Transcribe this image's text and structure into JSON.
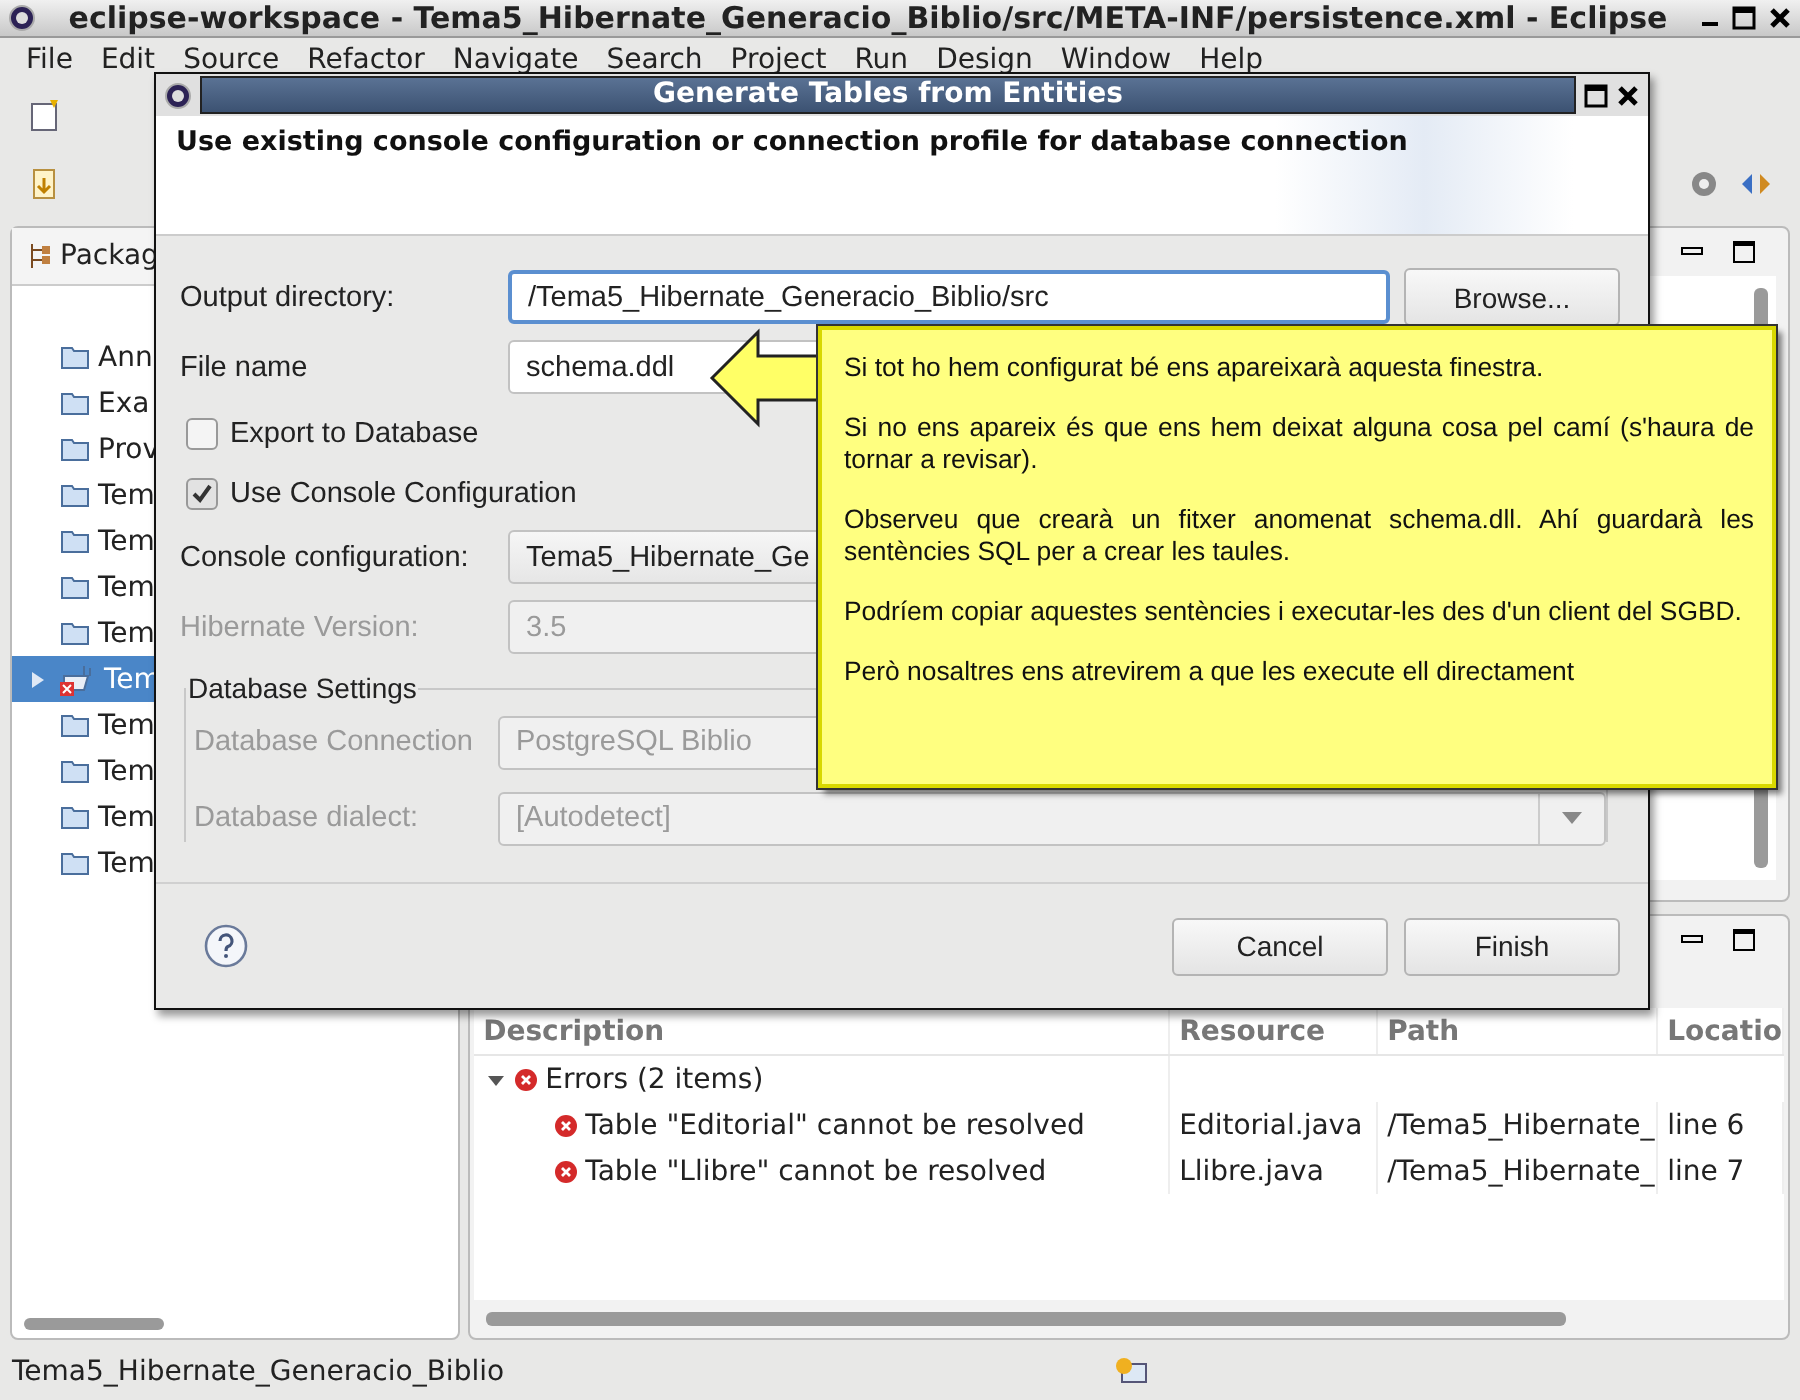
{
  "window": {
    "title": "eclipse-workspace - Tema5_Hibernate_Generacio_Biblio/src/META-INF/persistence.xml - Eclipse"
  },
  "menu": [
    "File",
    "Edit",
    "Source",
    "Refactor",
    "Navigate",
    "Search",
    "Project",
    "Run",
    "Design",
    "Window",
    "Help"
  ],
  "package_explorer": {
    "tab": "Packag",
    "items": [
      {
        "label": "Ann",
        "kind": "folder",
        "selected": false
      },
      {
        "label": "Exa",
        "kind": "folder",
        "selected": false
      },
      {
        "label": "Prov",
        "kind": "folder",
        "selected": false
      },
      {
        "label": "Tem",
        "kind": "folder",
        "selected": false
      },
      {
        "label": "Tem",
        "kind": "folder",
        "selected": false
      },
      {
        "label": "Tem",
        "kind": "folder",
        "selected": false
      },
      {
        "label": "Tem",
        "kind": "folder",
        "selected": false
      },
      {
        "label": "Tem",
        "kind": "project",
        "selected": true
      },
      {
        "label": "Tem",
        "kind": "folder",
        "selected": false
      },
      {
        "label": "Tem",
        "kind": "folder",
        "selected": false
      },
      {
        "label": "Tem",
        "kind": "folder",
        "selected": false
      },
      {
        "label": "Tem",
        "kind": "folder",
        "selected": false
      }
    ]
  },
  "problems": {
    "columns": [
      "Description",
      "Resource",
      "Path",
      "Locatio"
    ],
    "groups": [
      {
        "label": "Errors (2 items)",
        "expanded": true,
        "children": [
          {
            "description": "Table \"Editorial\" cannot be resolved",
            "resource": "Editorial.java",
            "path": "/Tema5_Hibernate_",
            "location": "line 6"
          },
          {
            "description": "Table \"Llibre\" cannot be resolved",
            "resource": "Llibre.java",
            "path": "/Tema5_Hibernate_",
            "location": "line 7"
          }
        ]
      }
    ]
  },
  "status_bar": {
    "text": "Tema5_Hibernate_Generacio_Biblio"
  },
  "dialog": {
    "title": "Generate Tables from Entities",
    "message": "Use existing console configuration or connection profile for database connection",
    "fields": [
      {
        "kind": "text",
        "label": "Output directory:",
        "value": "/Tema5_Hibernate_Generacio_Biblio/src",
        "focused": true,
        "disabled": false,
        "button": "Browse..."
      },
      {
        "kind": "text",
        "label": "File name",
        "value": "schema.ddl",
        "focused": false,
        "disabled": false
      },
      {
        "kind": "checkbox",
        "label": "Export to Database",
        "checked": false
      },
      {
        "kind": "checkbox",
        "label": "Use Console Configuration",
        "checked": true
      },
      {
        "kind": "combo",
        "label": "Console configuration:",
        "value": "Tema5_Hibernate_Ge",
        "focused": false,
        "disabled": false
      },
      {
        "kind": "text",
        "label": "Hibernate Version:",
        "value": "3.5",
        "focused": false,
        "disabled": true
      }
    ],
    "group": {
      "title": "Database Settings",
      "fields": [
        {
          "kind": "text",
          "label": "Database Connection",
          "value": "PostgreSQL Biblio",
          "focused": false,
          "disabled": true
        },
        {
          "kind": "combo",
          "label": "Database dialect:",
          "value": "[Autodetect]",
          "focused": false,
          "disabled": true
        }
      ]
    },
    "buttons": [
      "Cancel",
      "Finish"
    ]
  },
  "callout": {
    "paragraphs": [
      "Si tot ho hem configurat bé ens apareixarà aquesta finestra.",
      "Si no ens apareix és que ens hem deixat alguna cosa pel camí (s'haura de tornar a revisar).",
      "Observeu que crearà un fitxer anomenat schema.dll. Ahí guardarà les sentències SQL per a crear les taules.",
      "Podríem copiar aquestes sentències i executar-les des d'un client del SGBD.",
      "Però nosaltres ens atrevirem a que les execute ell directament"
    ]
  }
}
